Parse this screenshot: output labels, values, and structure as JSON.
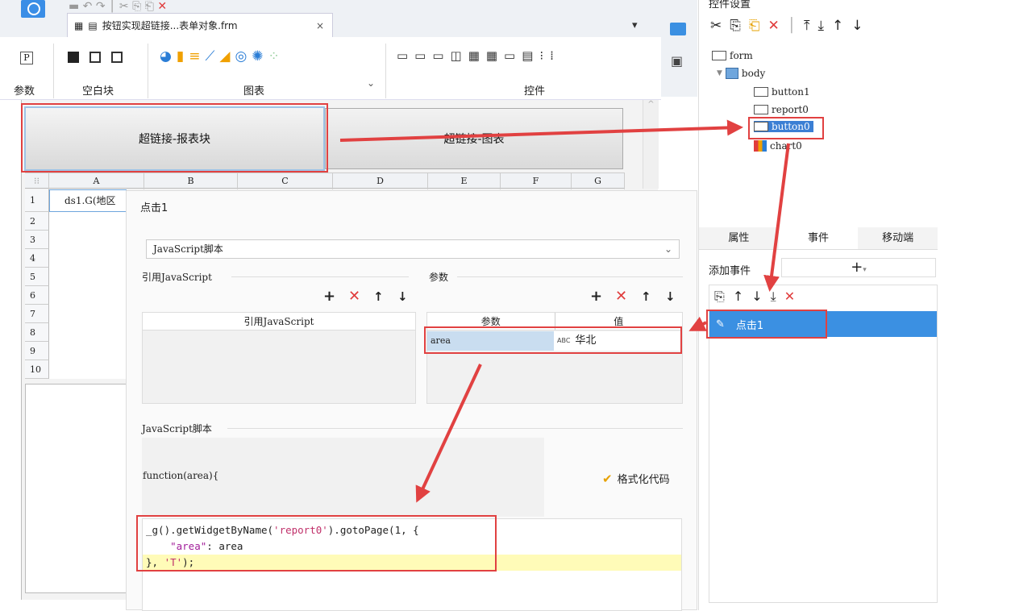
{
  "tab": {
    "label": "按钮实现超链接...表单对象.frm",
    "close": "×"
  },
  "ribbon": {
    "groups": [
      "参数",
      "空白块",
      "图表",
      "控件"
    ],
    "param_icon": "P"
  },
  "canvas": {
    "button_left": "超链接-报表块",
    "button_right": "超链接-图表"
  },
  "sheet": {
    "columns": [
      "A",
      "B",
      "C",
      "D",
      "E",
      "F",
      "G"
    ],
    "rows": [
      "1",
      "2",
      "3",
      "4",
      "5",
      "6",
      "7",
      "8",
      "9",
      "10"
    ],
    "cell_a1": "ds1.G(地区"
  },
  "dialog": {
    "title": "点击1",
    "type": "JavaScript脚本",
    "ref_section": "引用JavaScript",
    "param_section": "参数",
    "ref_table_header": "引用JavaScript",
    "param_headers": [
      "参数",
      "值"
    ],
    "param": {
      "name": "area",
      "type_icon": "ABC",
      "value": "华北"
    },
    "script_section": "JavaScript脚本",
    "func_signature": "function(area){",
    "format_button": "格式化代码",
    "code": {
      "l1a": "_g().getWidgetByName(",
      "l1b": "'report0'",
      "l1c": ").gotoPage(1, {",
      "l2a": "\"area\"",
      "l2b": ": area",
      "l3a": "}, ",
      "l3b": "'T'",
      "l3c": ");"
    }
  },
  "right_panel": {
    "title": "控件设置",
    "tree": {
      "form": "form",
      "body": "body",
      "button1": "button1",
      "report0": "report0",
      "button0": "button0",
      "chart0": "chart0"
    },
    "tabs": [
      "属性",
      "事件",
      "移动端"
    ],
    "add_event_label": "添加事件",
    "add_event_symbol": "+",
    "event_item": "点击1"
  },
  "colors": {
    "accent": "#3b90e2",
    "annotation": "#e14141",
    "highlight": "#fffbb8"
  }
}
